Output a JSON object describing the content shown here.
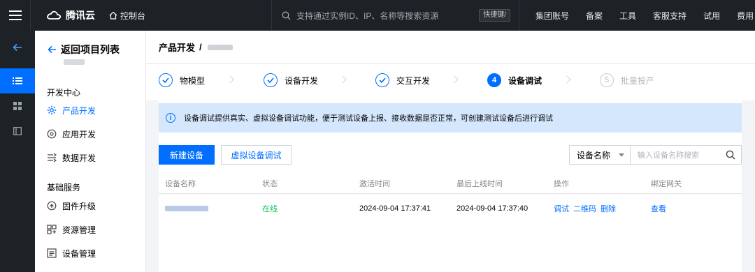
{
  "topbar": {
    "logo_text": "腾讯云",
    "console_label": "控制台",
    "search_placeholder": "支持通过实例ID、IP、名称等搜索资源",
    "shortcut_label": "快捷键/",
    "links": [
      "集团账号",
      "备案",
      "工具",
      "客服支持",
      "试用",
      "费用"
    ]
  },
  "sidenav": {
    "back_label": "返回项目列表",
    "groups": [
      {
        "title": "开发中心",
        "items": [
          {
            "label": "产品开发",
            "icon": "gear-icon",
            "active": true
          },
          {
            "label": "应用开发",
            "icon": "app-icon",
            "active": false
          },
          {
            "label": "数据开发",
            "icon": "data-icon",
            "active": false
          }
        ]
      },
      {
        "title": "基础服务",
        "items": [
          {
            "label": "固件升级",
            "icon": "firmware-icon",
            "active": false
          },
          {
            "label": "资源管理",
            "icon": "resource-icon",
            "active": false
          },
          {
            "label": "设备管理",
            "icon": "device-icon",
            "active": false
          }
        ]
      }
    ]
  },
  "breadcrumb": {
    "root": "产品开发",
    "sep": "/"
  },
  "steps": [
    {
      "label": "物模型",
      "state": "done",
      "mark": ""
    },
    {
      "label": "设备开发",
      "state": "done",
      "mark": ""
    },
    {
      "label": "交互开发",
      "state": "done",
      "mark": ""
    },
    {
      "label": "设备调试",
      "state": "current",
      "mark": "4"
    },
    {
      "label": "批量投产",
      "state": "todo",
      "mark": "5"
    }
  ],
  "notice": "设备调试提供真实、虚拟设备调试功能，便于测试设备上报、接收数据是否正常，可创建测试设备后进行调试",
  "actions": {
    "new_device": "新建设备",
    "virtual_debug": "虚拟设备调试"
  },
  "filter": {
    "field": "设备名称",
    "placeholder": "输入设备名称搜索"
  },
  "table": {
    "columns": [
      "设备名称",
      "状态",
      "激活时间",
      "最后上线时间",
      "操作",
      "绑定网关"
    ],
    "rows": [
      {
        "status": "在线",
        "activated": "2024-09-04 17:37:41",
        "last_online": "2024-09-04 17:37:40",
        "ops": [
          "调试",
          "二维码",
          "删除"
        ],
        "gateway": "查看"
      }
    ]
  },
  "colors": {
    "accent": "#006eff",
    "online": "#0abf5b",
    "topbar": "#1c2226",
    "notice_bg": "#d5e7fd"
  }
}
